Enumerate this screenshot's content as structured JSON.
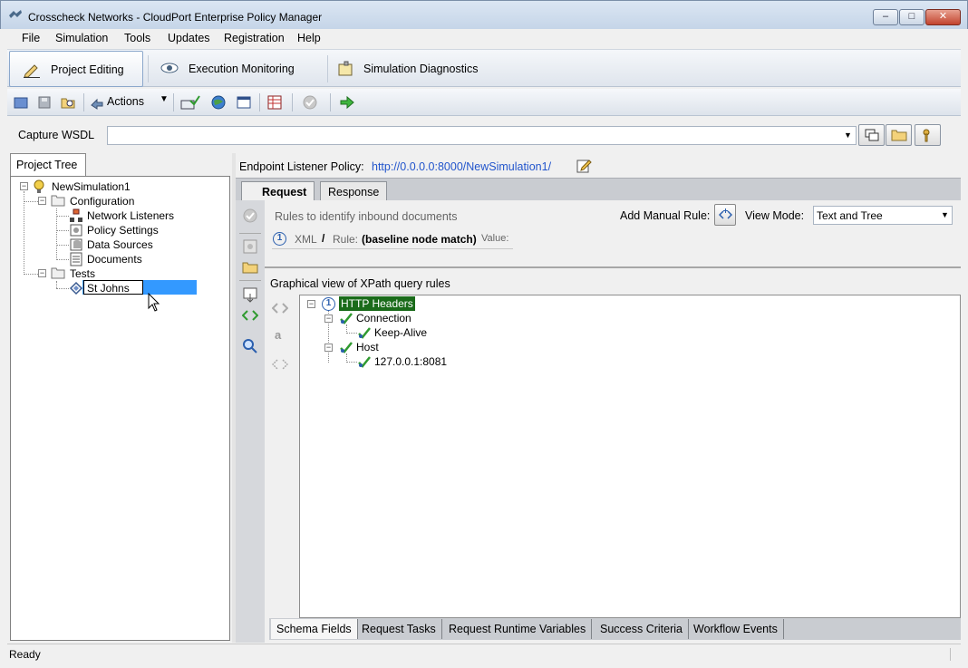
{
  "window": {
    "title": "Crosscheck Networks - CloudPort Enterprise Policy Manager",
    "min_label": "–",
    "max_label": "□",
    "close_label": "✕"
  },
  "menu": [
    "File",
    "Simulation",
    "Tools",
    "Updates",
    "Registration",
    "Help"
  ],
  "modes": {
    "project_editing": "Project Editing",
    "execution_monitoring": "Execution Monitoring",
    "simulation_diagnostics": "Simulation Diagnostics"
  },
  "toolbar": {
    "actions_label": "Actions",
    "icons": [
      "open-project-icon",
      "save-icon",
      "open-browse-icon",
      "actions-icon",
      "dropdown-icon",
      "validate-icon",
      "globe-icon",
      "window-icon",
      "table-icon",
      "check-disabled-icon",
      "run-arrow-icon"
    ]
  },
  "wsdl": {
    "label": "Capture WSDL",
    "value": ""
  },
  "project_tree": {
    "tab_label": "Project Tree",
    "root": "NewSimulation1",
    "configuration": "Configuration",
    "config_items": [
      "Network Listeners",
      "Policy Settings",
      "Data Sources",
      "Documents"
    ],
    "tests": "Tests",
    "editing_value": "St Johns"
  },
  "endpoint": {
    "label": "Endpoint Listener Policy:",
    "url": "http://0.0.0.0:8000/NewSimulation1/"
  },
  "request_tabs": {
    "request": "Request",
    "response": "Response"
  },
  "rules": {
    "heading": "Rules to identify inbound documents",
    "add_manual_label": "Add Manual Rule:",
    "view_mode_label": "View Mode:",
    "view_mode_value": "Text and Tree",
    "rule_number": "1",
    "rule_type": "XML",
    "rule_sep": "/",
    "rule_label": "Rule:",
    "rule_value": "(baseline node match)",
    "value_label": "Value:"
  },
  "graph": {
    "heading": "Graphical view of XPath query rules",
    "root_number": "1",
    "root_label": "HTTP Headers",
    "nodes": [
      {
        "label": "Connection",
        "child": "Keep-Alive"
      },
      {
        "label": "Host",
        "child": "127.0.0.1:8081"
      }
    ]
  },
  "bottom_tabs": [
    "Schema Fields",
    "Request Tasks",
    "Request Runtime Variables",
    "Success Criteria",
    "Workflow Events"
  ],
  "status": {
    "text": "Ready"
  },
  "colors": {
    "selection": "#3399ff",
    "link": "#2255cc",
    "tree_highlight": "#1a6b1a"
  }
}
